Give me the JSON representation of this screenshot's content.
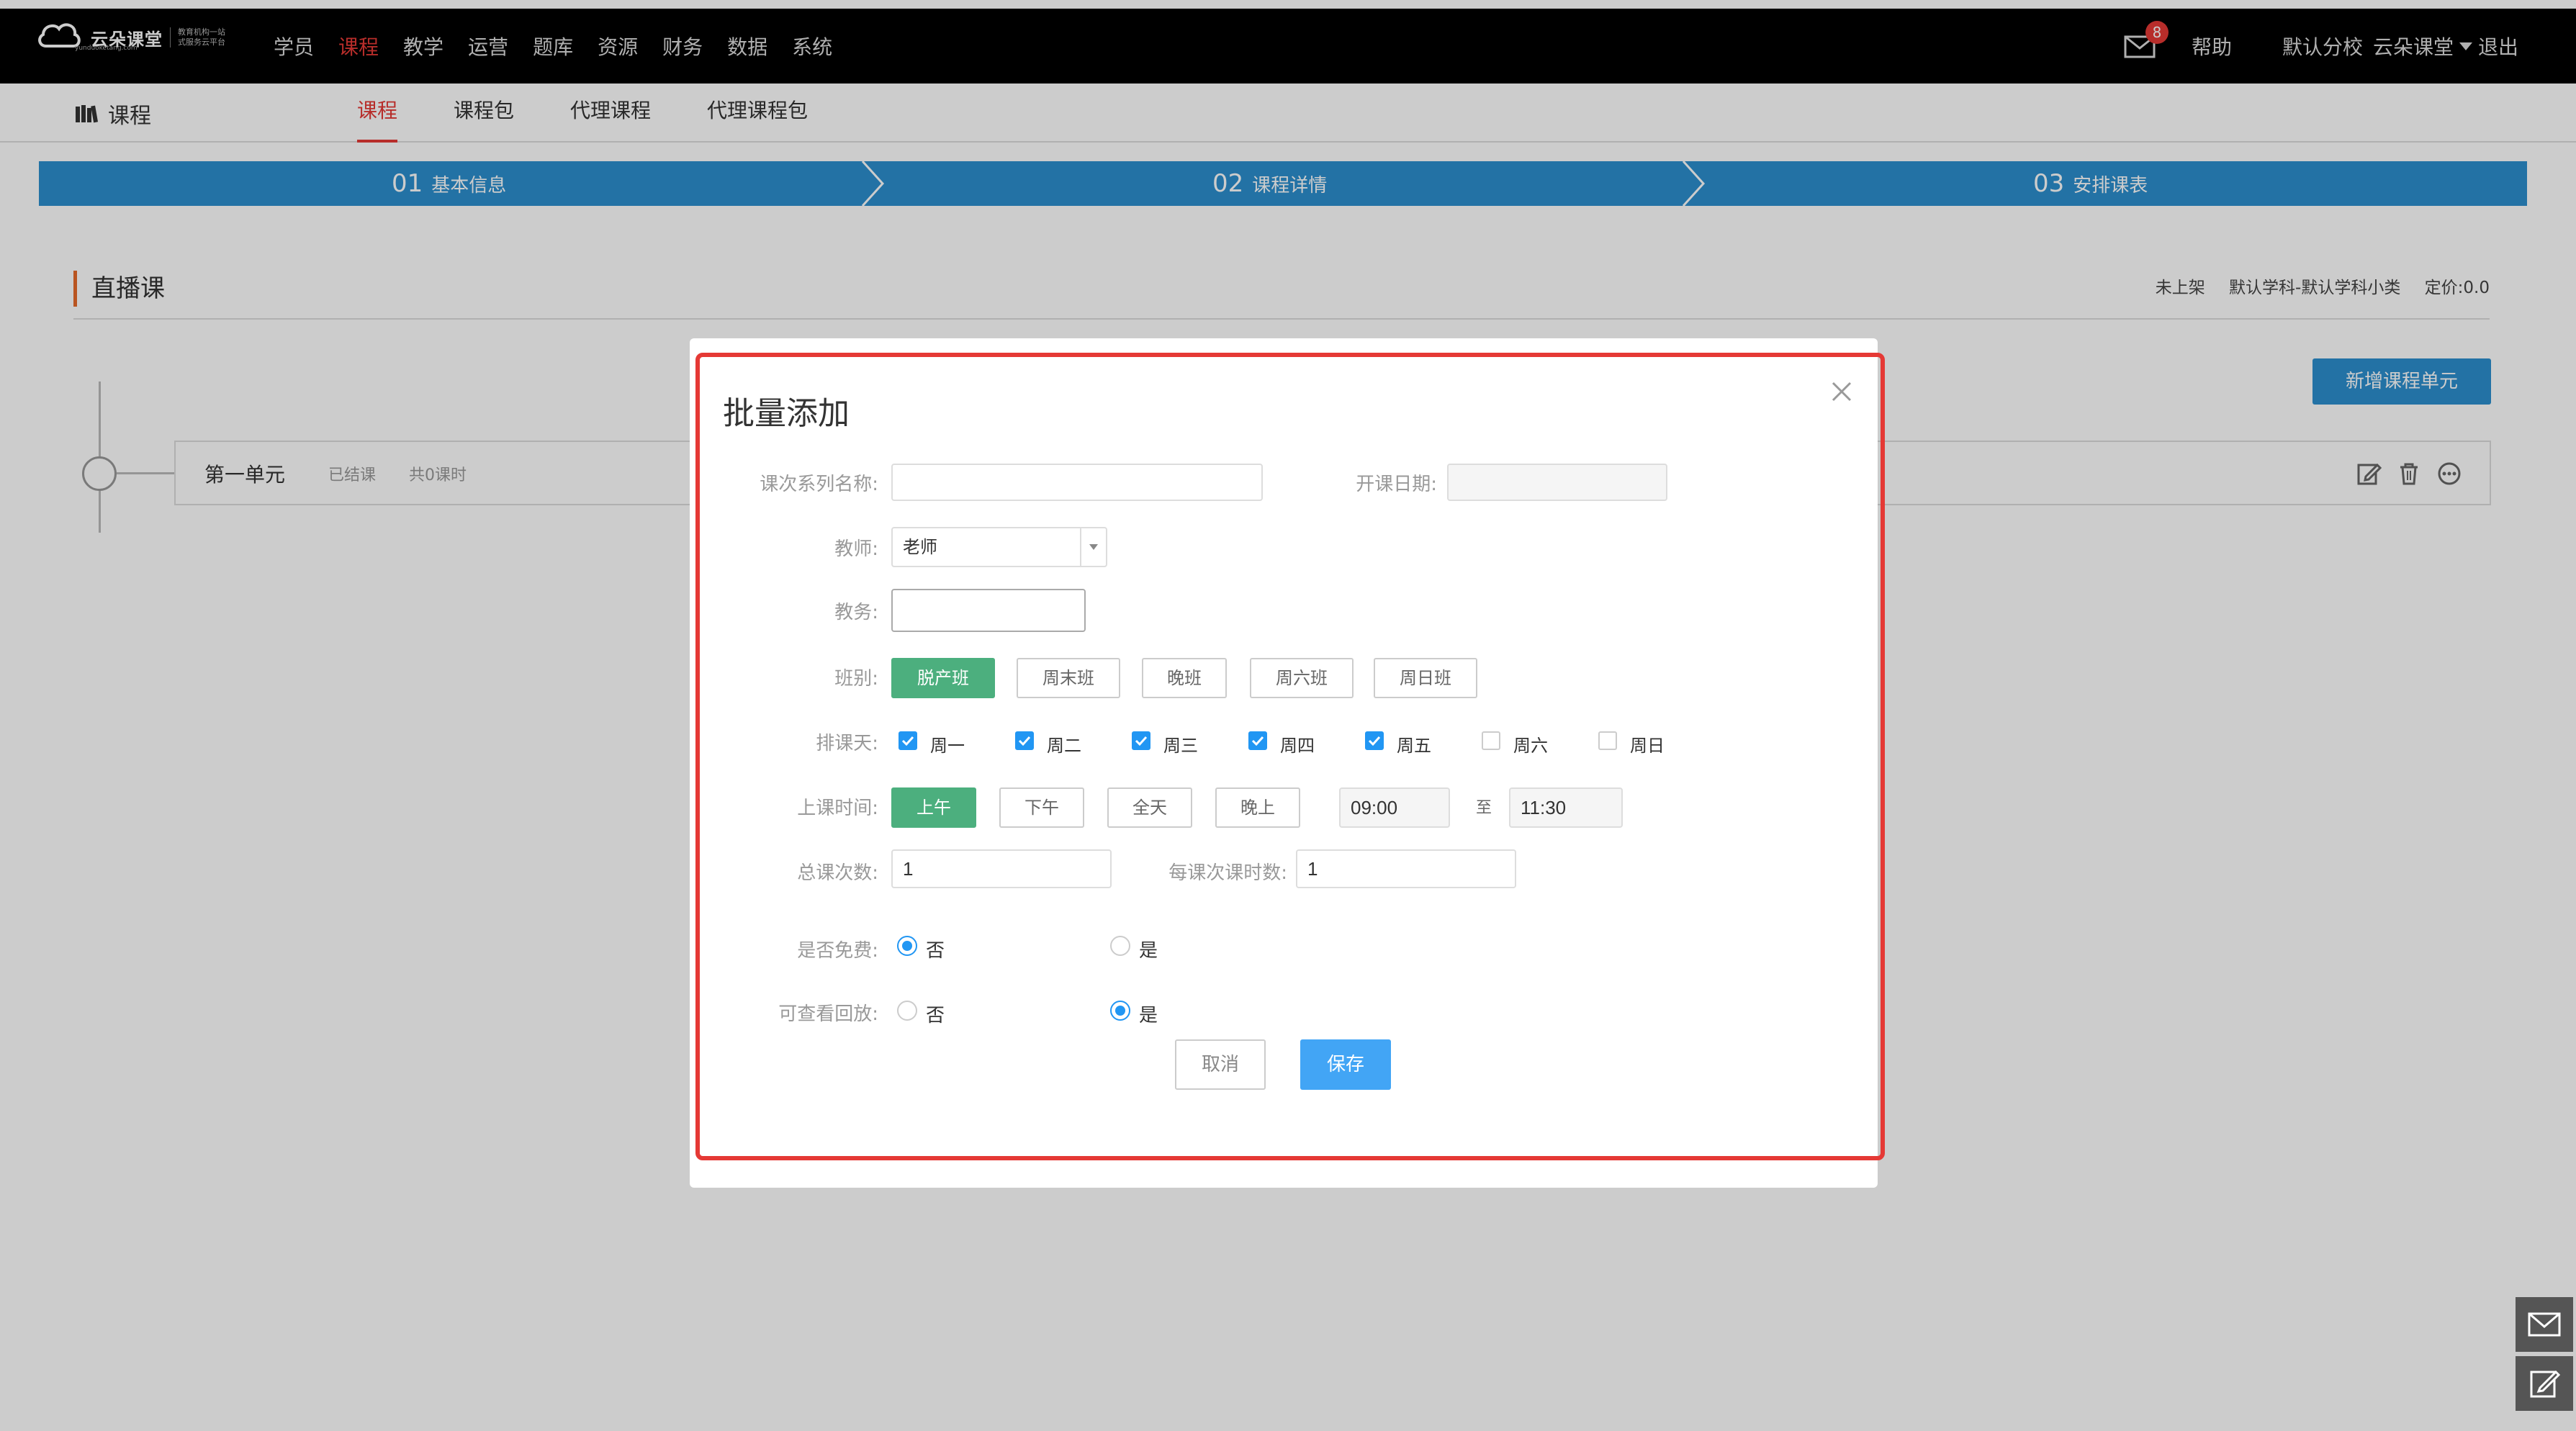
{
  "header": {
    "logo_text": "云朵课堂",
    "logo_tagline_1": "教育机构一站",
    "logo_tagline_2": "式服务云平台",
    "logo_url": "yunduoketang.com",
    "nav": [
      "学员",
      "课程",
      "教学",
      "运营",
      "题库",
      "资源",
      "财务",
      "数据",
      "系统"
    ],
    "nav_active_index": 1,
    "mail_badge": "8",
    "help": "帮助",
    "school": "默认分校",
    "user": "云朵课堂",
    "logout": "退出"
  },
  "subheader": {
    "title": "课程",
    "tabs": [
      "课程",
      "课程包",
      "代理课程",
      "代理课程包"
    ]
  },
  "steps": [
    {
      "num": "01",
      "label": "基本信息"
    },
    {
      "num": "02",
      "label": "课程详情"
    },
    {
      "num": "03",
      "label": "安排课表"
    }
  ],
  "content": {
    "section_title": "直播课",
    "meta_status": "未上架",
    "meta_subject": "默认学科-默认学科小类",
    "meta_price": "定价:0.0",
    "new_unit_button": "新增课程单元",
    "unit": {
      "name": "第一单元",
      "status": "已结课",
      "count": "共0课时"
    }
  },
  "modal": {
    "title": "批量添加",
    "series_name_label": "课次系列名称:",
    "series_name_value": "",
    "start_date_label": "开课日期:",
    "start_date_value": "",
    "teacher_label": "教师:",
    "teacher_value": "老师",
    "assistant_label": "教务:",
    "assistant_value": "",
    "class_label": "班别:",
    "class_options": [
      "脱产班",
      "周末班",
      "晚班",
      "周六班",
      "周日班"
    ],
    "class_active_index": 0,
    "days_label": "排课天:",
    "days": [
      {
        "label": "周一",
        "checked": true
      },
      {
        "label": "周二",
        "checked": true
      },
      {
        "label": "周三",
        "checked": true
      },
      {
        "label": "周四",
        "checked": true
      },
      {
        "label": "周五",
        "checked": true
      },
      {
        "label": "周六",
        "checked": false
      },
      {
        "label": "周日",
        "checked": false
      }
    ],
    "time_label": "上课时间:",
    "time_options": [
      "上午",
      "下午",
      "全天",
      "晚上"
    ],
    "time_active_index": 0,
    "time_start": "09:00",
    "time_to": "至",
    "time_end": "11:30",
    "total_label": "总课次数:",
    "total_value": "1",
    "per_label": "每课次课时数:",
    "per_value": "1",
    "free_label": "是否免费:",
    "free_no": "否",
    "free_yes": "是",
    "free_selected": "否",
    "replay_label": "可查看回放:",
    "replay_no": "否",
    "replay_yes": "是",
    "replay_selected": "是",
    "cancel": "取消",
    "save": "保存"
  },
  "colors": {
    "header_bg": "#000000",
    "accent_red": "#e53935",
    "step_blue": "#2c8fcf",
    "green": "#4caf7e",
    "checkbox_blue": "#2196f3",
    "save_blue": "#42a5f5"
  },
  "icons": [
    "mail-icon",
    "books-icon",
    "close-icon",
    "edit-icon",
    "trash-icon",
    "more-icon",
    "dropdown-caret-icon",
    "check-icon"
  ]
}
